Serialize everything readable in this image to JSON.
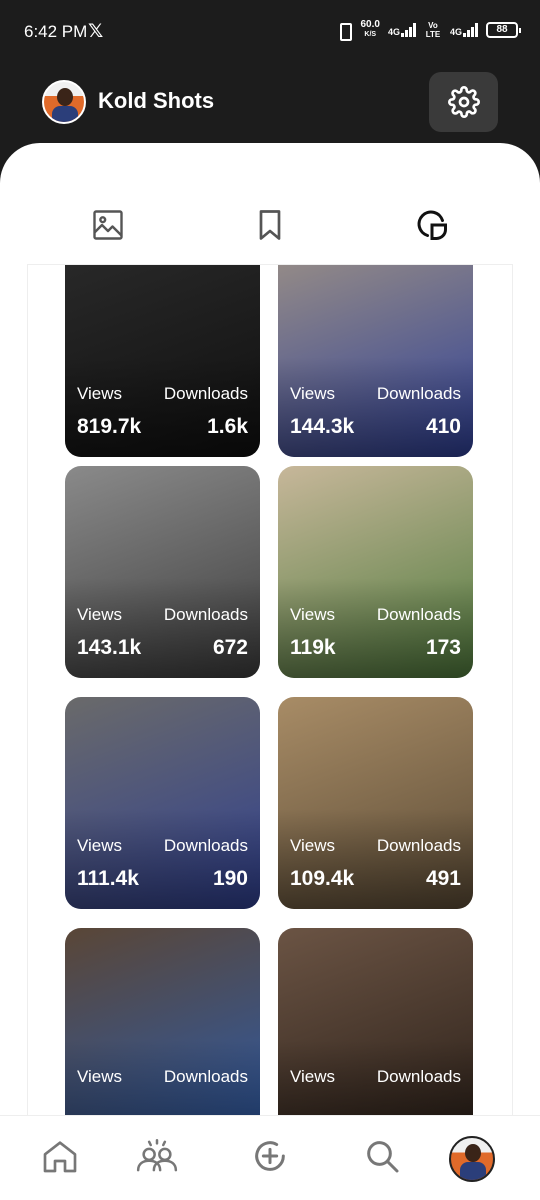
{
  "status_bar": {
    "time": "6:42 PM",
    "x_logo": "𝕏",
    "speed_value": "60.0",
    "speed_unit": "K/S",
    "net1": "4G",
    "volte": "Vo LTE",
    "net2": "4G",
    "battery": "88"
  },
  "header": {
    "title": "Kold Shots",
    "settings_icon": "gear-icon"
  },
  "tabs": [
    {
      "icon": "image-icon",
      "active": false
    },
    {
      "icon": "bookmark-icon",
      "active": false
    },
    {
      "icon": "stats-icon",
      "active": true
    }
  ],
  "cards": [
    {
      "views_label": "Views",
      "downloads_label": "Downloads",
      "views": "819.7k",
      "downloads": "1.6k",
      "palette": [
        "#2a2a2a",
        "#0f0f0f"
      ]
    },
    {
      "views_label": "Views",
      "downloads_label": "Downloads",
      "views": "144.3k",
      "downloads": "410",
      "palette": [
        "#9a8f86",
        "#2e3f96"
      ]
    },
    {
      "views_label": "Views",
      "downloads_label": "Downloads",
      "views": "143.1k",
      "downloads": "672",
      "palette": [
        "#8a8a8a",
        "#3d3d3d"
      ]
    },
    {
      "views_label": "Views",
      "downloads_label": "Downloads",
      "views": "119k",
      "downloads": "173",
      "palette": [
        "#c7b79a",
        "#4f7a3c"
      ]
    },
    {
      "views_label": "Views",
      "downloads_label": "Downloads",
      "views": "111.4k",
      "downloads": "190",
      "palette": [
        "#6a6a6a",
        "#2f3f8f"
      ]
    },
    {
      "views_label": "Views",
      "downloads_label": "Downloads",
      "views": "109.4k",
      "downloads": "491",
      "palette": [
        "#a88c66",
        "#5a4a35"
      ]
    },
    {
      "views_label": "Views",
      "downloads_label": "Downloads",
      "views": "",
      "downloads": "",
      "palette": [
        "#5a4636",
        "#2d5aa6"
      ]
    },
    {
      "views_label": "Views",
      "downloads_label": "Downloads",
      "views": "",
      "downloads": "",
      "palette": [
        "#6b5444",
        "#2a1f18"
      ]
    }
  ],
  "bottom_nav": [
    {
      "icon": "home-icon"
    },
    {
      "icon": "community-icon"
    },
    {
      "icon": "add-icon"
    },
    {
      "icon": "search-icon"
    },
    {
      "icon": "profile-avatar"
    }
  ]
}
